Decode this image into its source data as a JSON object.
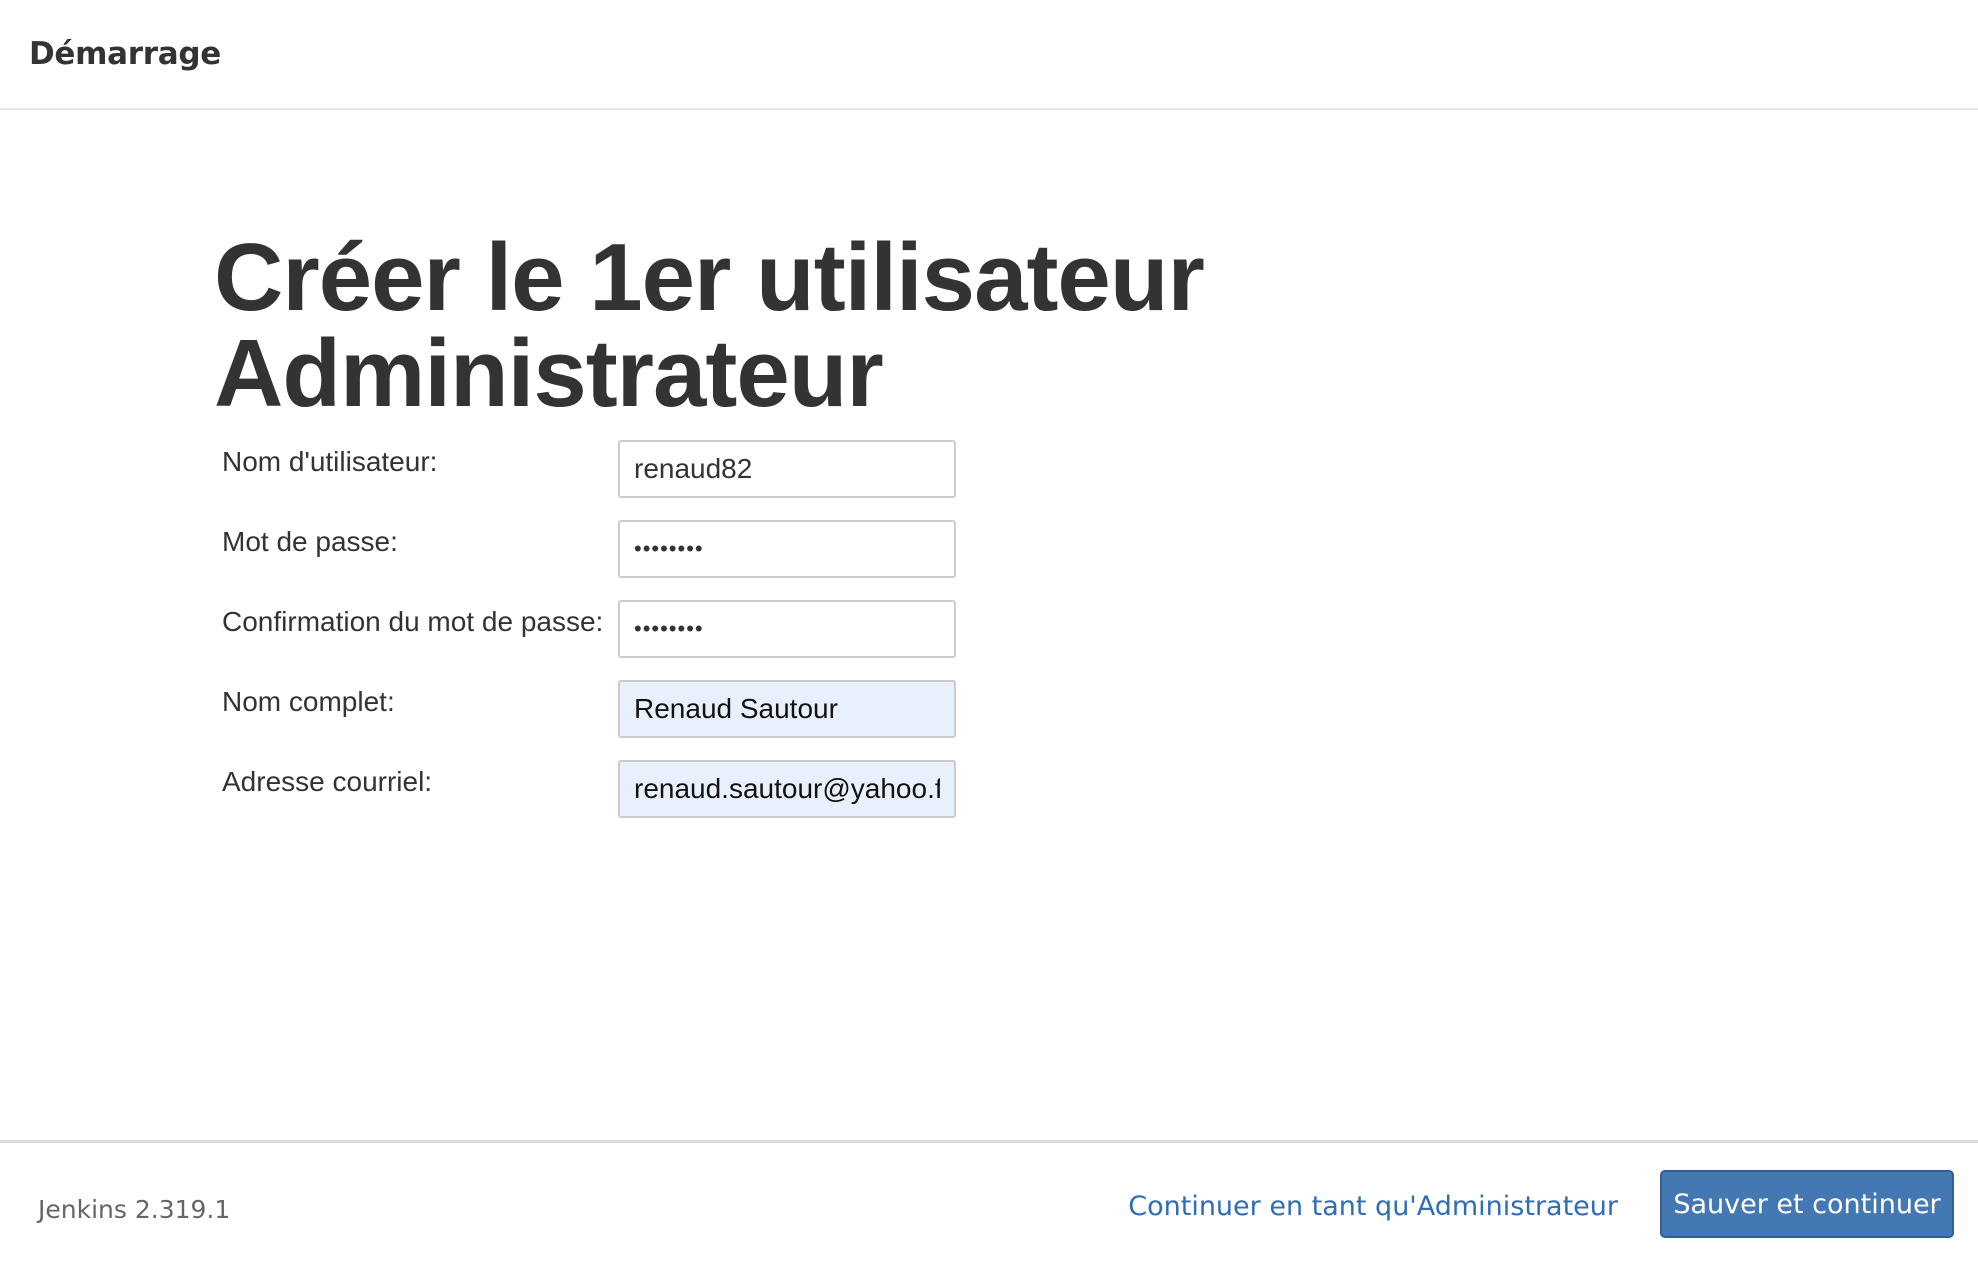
{
  "header": {
    "title": "Démarrage"
  },
  "page": {
    "title_line1": "Créer le 1er utilisateur",
    "title_line2": "Administrateur"
  },
  "form": {
    "username": {
      "label": "Nom d'utilisateur:",
      "value": "renaud82"
    },
    "password": {
      "label": "Mot de passe:",
      "value": "••••••••"
    },
    "password_confirm": {
      "label": "Confirmation du mot de passe:",
      "value": "••••••••"
    },
    "fullname": {
      "label": "Nom complet:",
      "value": "Renaud Sautour"
    },
    "email": {
      "label": "Adresse courriel:",
      "value": "renaud.sautour@yahoo.f"
    }
  },
  "footer": {
    "version": "Jenkins 2.319.1",
    "continue_admin_label": "Continuer en tant qu'Administrateur",
    "save_label": "Sauver et continuer"
  },
  "colors": {
    "primary_button": "#4378b3",
    "link": "#2f6db5",
    "autofill_bg": "#e8f0fe"
  }
}
